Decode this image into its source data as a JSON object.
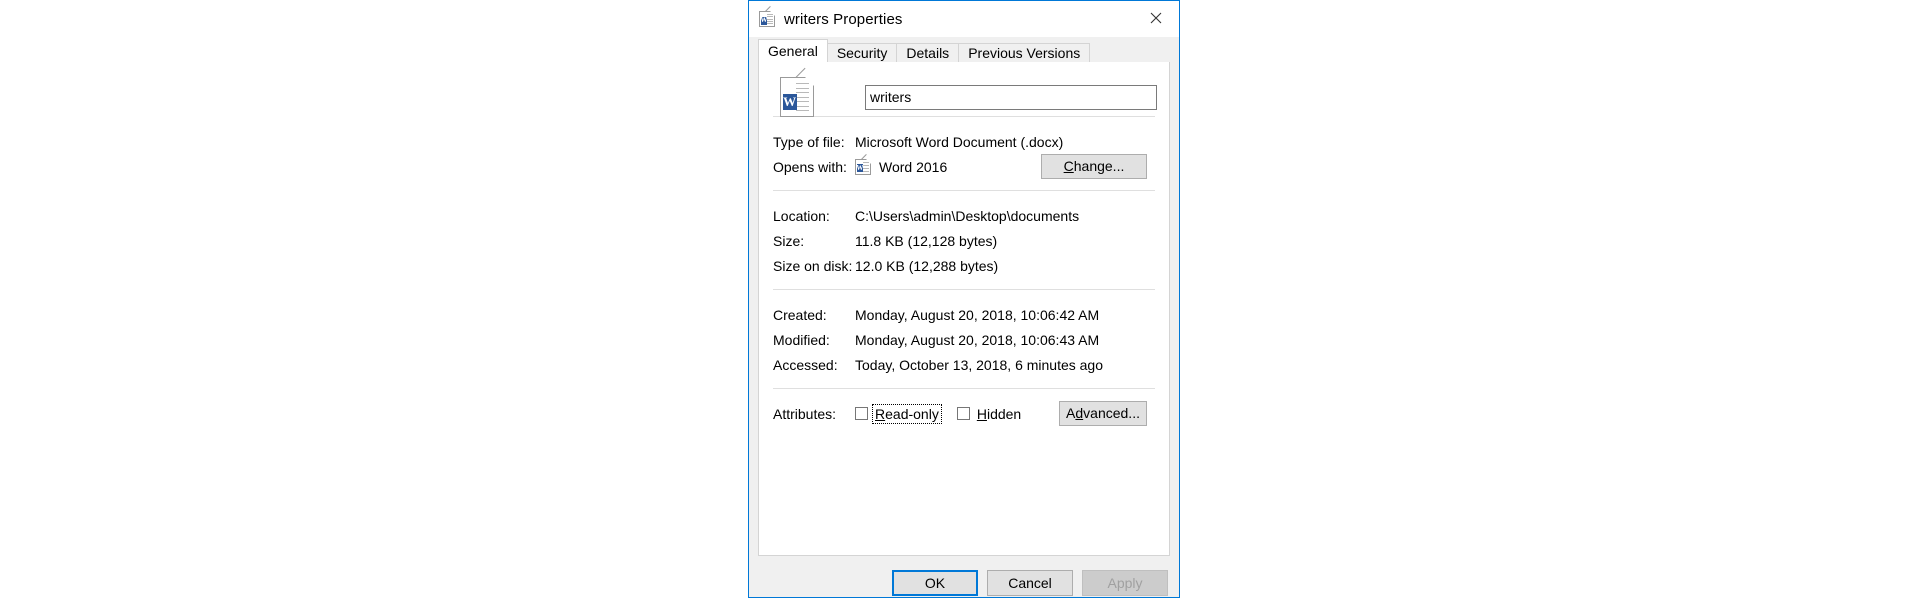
{
  "window": {
    "title": "writers Properties",
    "icon": "word-document-icon",
    "close_label": "✕",
    "accent_color": "#0078d7",
    "chrome_color": "#f0f0f0"
  },
  "tabs": [
    {
      "label": "General",
      "active": true
    },
    {
      "label": "Security",
      "active": false
    },
    {
      "label": "Details",
      "active": false
    },
    {
      "label": "Previous Versions",
      "active": false
    }
  ],
  "general": {
    "file_icon": "word-document-icon",
    "filename": {
      "value": "writers",
      "placeholder": "File name"
    },
    "info": [
      {
        "label": "Type of file:",
        "value": "Microsoft Word Document (.docx)"
      }
    ],
    "opens_with": {
      "label": "Opens with:",
      "app_icon": "word-app-icon",
      "app_name": "Word 2016",
      "button": "Change...",
      "button_accel": "C"
    },
    "location": [
      {
        "label": "Location:",
        "value": "C:\\Users\\admin\\Desktop\\documents"
      },
      {
        "label": "Size:",
        "value": "11.8 KB (12,128 bytes)"
      },
      {
        "label": "Size on disk:",
        "value": "12.0 KB (12,288 bytes)"
      }
    ],
    "dates": [
      {
        "label": "Created:",
        "value": "Monday, August 20, 2018, 10:06:42 AM"
      },
      {
        "label": "Modified:",
        "value": "Monday, August 20, 2018, 10:06:43 AM"
      },
      {
        "label": "Accessed:",
        "value": "Today, October 13, 2018, 6 minutes ago"
      }
    ],
    "attributes": {
      "label": "Attributes:",
      "readonly": {
        "label": "Read-only",
        "accel_prefix": "R",
        "accel_rest": "ead-only",
        "checked": false,
        "focused": true
      },
      "hidden": {
        "label": "Hidden",
        "accel_prefix": "H",
        "accel_rest": "idden",
        "checked": false,
        "focused": false
      },
      "advanced_button": {
        "label": "Advanced...",
        "prefix": "A",
        "accel": "d",
        "rest": "vanced..."
      }
    }
  },
  "footer": {
    "ok": "OK",
    "cancel": "Cancel",
    "apply": "Apply",
    "apply_enabled": false
  }
}
